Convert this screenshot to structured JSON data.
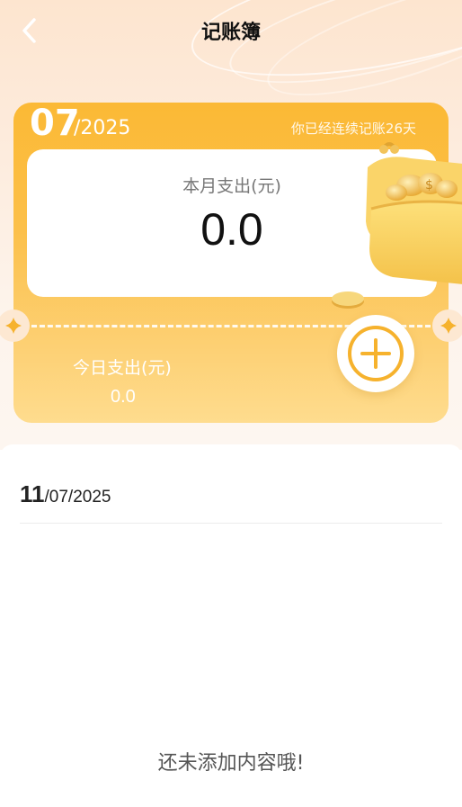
{
  "header": {
    "title": "记账簿"
  },
  "card": {
    "month": "07",
    "year_suffix": "/2025",
    "streak_text": "你已经连续记账26天",
    "month_expense_label": "本月支出(元)",
    "month_expense_value": "0.0",
    "today_expense_label": "今日支出(元)",
    "today_expense_value": "0.0"
  },
  "records": {
    "date_day": "11",
    "date_rest": "/07/2025",
    "empty_text": "还未添加内容哦!"
  },
  "icons": {
    "back": "chevron-left-icon",
    "add": "plus-circle-icon",
    "wallet": "coin-purse-icon",
    "notch": "diamond-icon"
  },
  "colors": {
    "card_top": "#fbb935",
    "card_bottom": "#fedc8e",
    "accent": "#f6b22d",
    "background_top": "#fde5cf"
  }
}
